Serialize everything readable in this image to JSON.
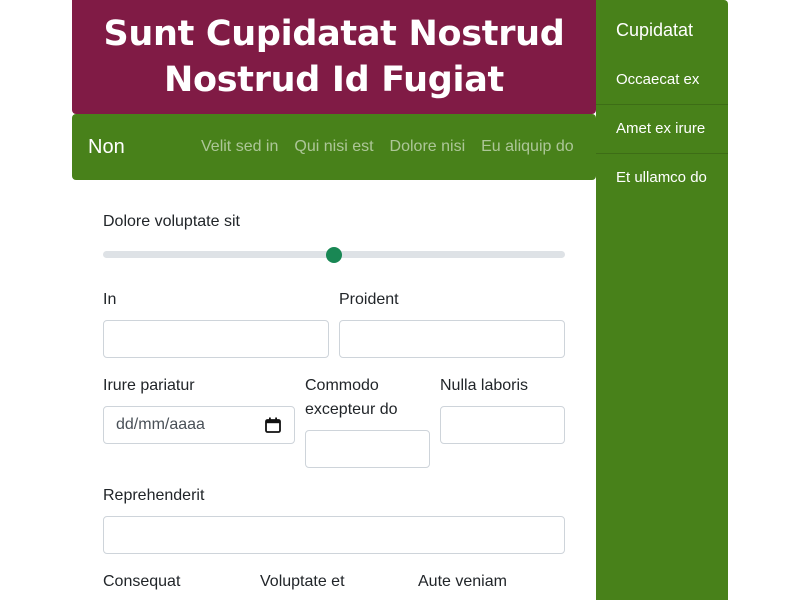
{
  "hero": {
    "title": "Sunt Cupidatat Nostrud Nostrud Id Fugiat"
  },
  "navbar": {
    "brand": "Non",
    "links": [
      "Velit sed in",
      "Qui nisi est",
      "Dolore nisi",
      "Eu aliquip do"
    ]
  },
  "sidebar": {
    "title": "Cupidatat",
    "items": [
      "Occaecat ex",
      "Amet ex irure",
      "Et ullamco do"
    ]
  },
  "form": {
    "range": {
      "label": "Dolore voluptate sit",
      "value": 50,
      "min": 0,
      "max": 100
    },
    "in_label": "In",
    "proident_label": "Proident",
    "irure_label": "Irure pariatur",
    "date_placeholder": "dd/mm/aaaa",
    "commodo_label": "Commodo excepteur do",
    "nulla_label": "Nulla laboris",
    "reprehenderit_label": "Reprehenderit",
    "consequat_label": "Consequat",
    "voluptate_label": "Voluptate et",
    "aute_label": "Aute veniam"
  },
  "colors": {
    "hero_bg": "#801b45",
    "nav_bg": "#48811a",
    "accent": "#198754"
  }
}
